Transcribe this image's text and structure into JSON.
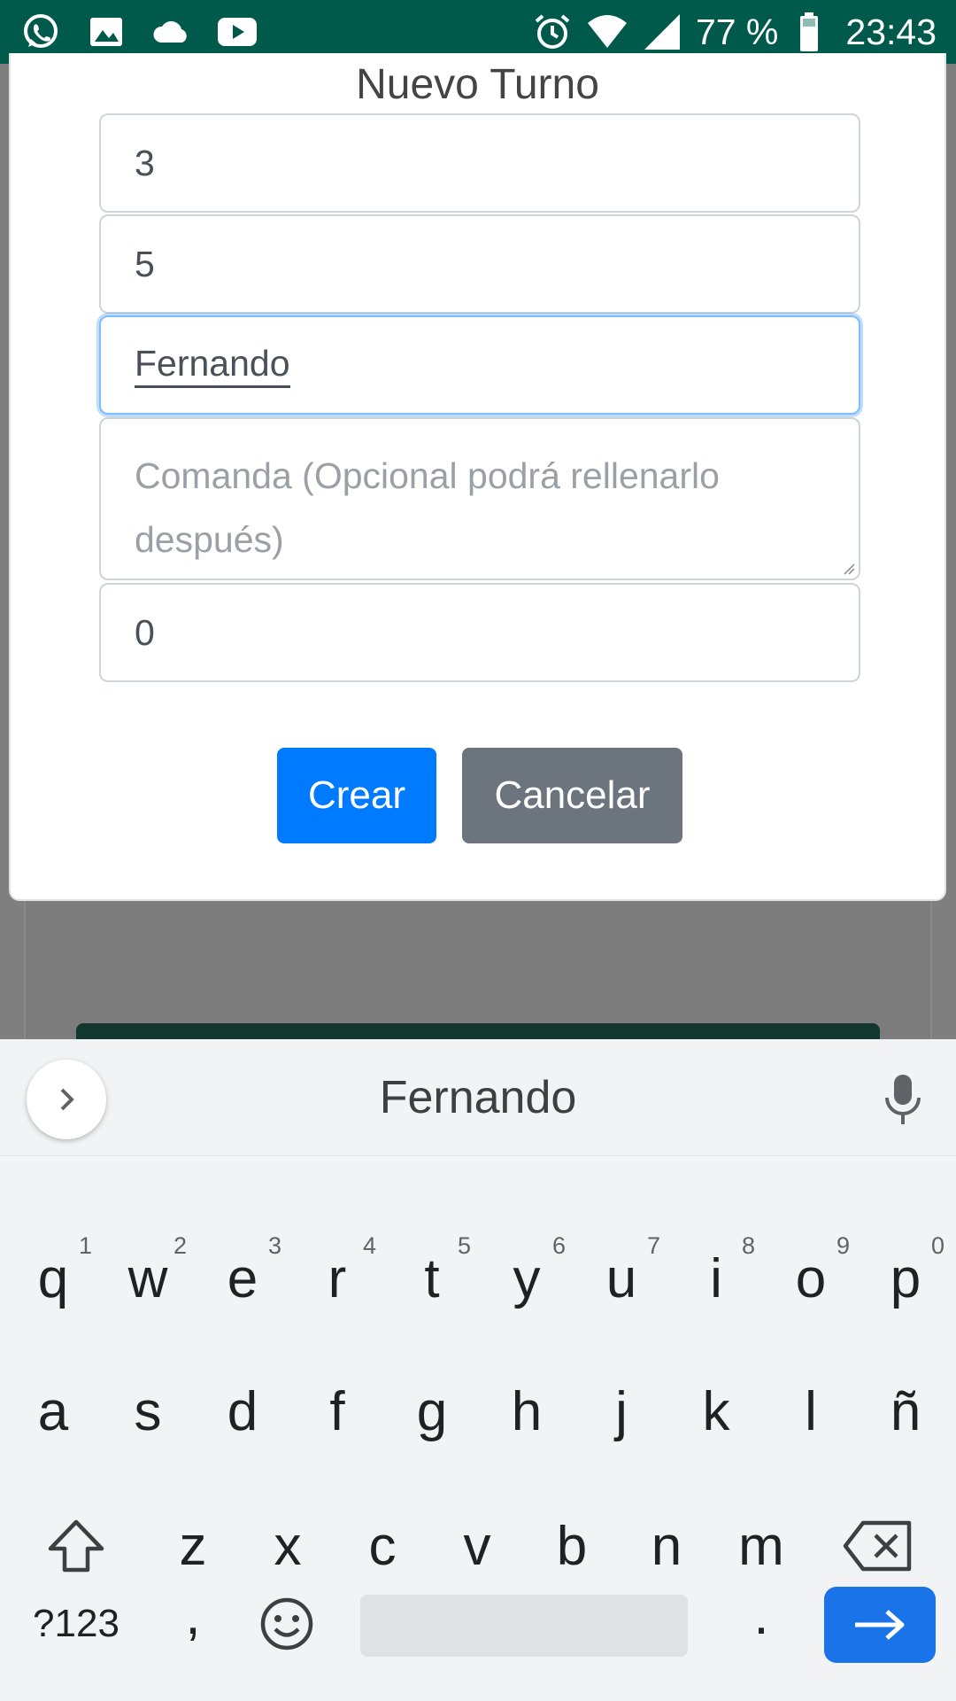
{
  "status_bar": {
    "battery": "77 %",
    "time": "23:43",
    "left_icons": [
      "whatsapp-icon",
      "image-icon",
      "cloud-icon",
      "youtube-icon"
    ],
    "right_icons": [
      "alarm-icon",
      "wifi-icon",
      "signal-icon",
      "battery-icon"
    ]
  },
  "modal": {
    "title": "Nuevo Turno",
    "fields": {
      "field1": "3",
      "field2": "5",
      "name": "Fernando",
      "comanda_placeholder": "Comanda (Opcional podrá rellenarlo después)",
      "field5": "0"
    },
    "buttons": {
      "create": "Crear",
      "cancel": "Cancelar"
    }
  },
  "keyboard": {
    "suggestion": "Fernando",
    "row1": [
      {
        "k": "q",
        "h": "1"
      },
      {
        "k": "w",
        "h": "2"
      },
      {
        "k": "e",
        "h": "3"
      },
      {
        "k": "r",
        "h": "4"
      },
      {
        "k": "t",
        "h": "5"
      },
      {
        "k": "y",
        "h": "6"
      },
      {
        "k": "u",
        "h": "7"
      },
      {
        "k": "i",
        "h": "8"
      },
      {
        "k": "o",
        "h": "9"
      },
      {
        "k": "p",
        "h": "0"
      }
    ],
    "row2": [
      "a",
      "s",
      "d",
      "f",
      "g",
      "h",
      "j",
      "k",
      "l",
      "ñ"
    ],
    "row3": [
      "z",
      "x",
      "c",
      "v",
      "b",
      "n",
      "m"
    ],
    "symbols": "?123",
    "comma": ",",
    "period": "."
  },
  "colors": {
    "status_bar": "#005a4c",
    "primary_button": "#007bff",
    "secondary_button": "#6c757d",
    "focus_border": "#80bdff",
    "enter_key": "#1a73e8"
  }
}
